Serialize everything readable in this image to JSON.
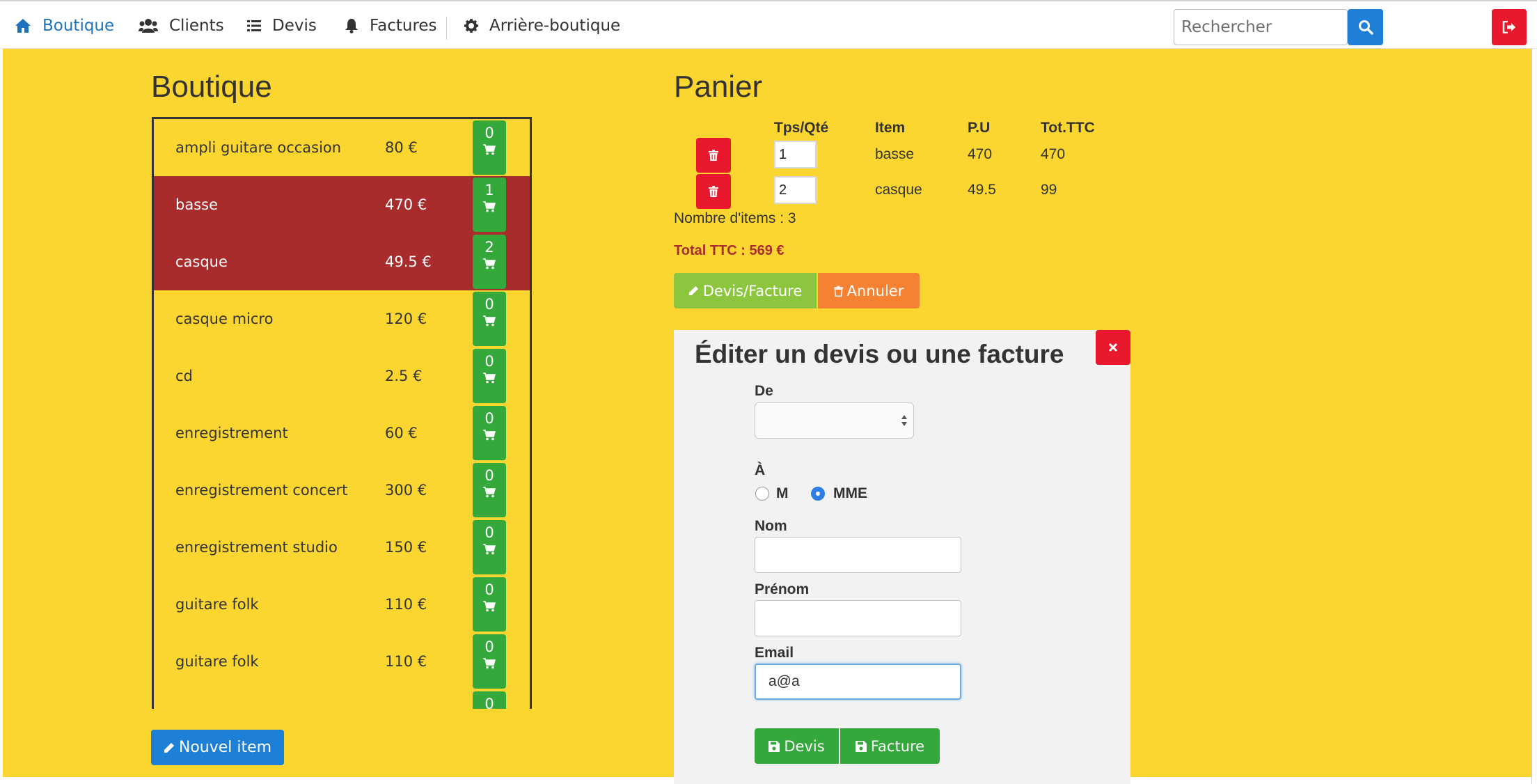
{
  "nav": {
    "items": [
      {
        "label": "Boutique",
        "icon": "home-icon"
      },
      {
        "label": "Clients",
        "icon": "users-icon"
      },
      {
        "label": "Devis",
        "icon": "list-icon"
      },
      {
        "label": "Factures",
        "icon": "bell-icon"
      },
      {
        "label": "Arrière-boutique",
        "icon": "gear-icon"
      }
    ],
    "search_placeholder": "Rechercher"
  },
  "boutique": {
    "title": "Boutique",
    "products": [
      {
        "name": "ampli guitare occasion",
        "price": "80 €",
        "count": "0",
        "selected": false
      },
      {
        "name": "basse",
        "price": "470 €",
        "count": "1",
        "selected": true
      },
      {
        "name": "casque",
        "price": "49.5 €",
        "count": "2",
        "selected": true
      },
      {
        "name": "casque micro",
        "price": "120 €",
        "count": "0",
        "selected": false
      },
      {
        "name": "cd",
        "price": "2.5 €",
        "count": "0",
        "selected": false
      },
      {
        "name": "enregistrement",
        "price": "60 €",
        "count": "0",
        "selected": false
      },
      {
        "name": "enregistrement concert",
        "price": "300 €",
        "count": "0",
        "selected": false
      },
      {
        "name": "enregistrement studio",
        "price": "150 €",
        "count": "0",
        "selected": false
      },
      {
        "name": "guitare folk",
        "price": "110 €",
        "count": "0",
        "selected": false
      },
      {
        "name": "guitare folk",
        "price": "110 €",
        "count": "0",
        "selected": false
      },
      {
        "name": "",
        "price": "",
        "count": "0",
        "selected": false
      }
    ],
    "new_item_label": "Nouvel item"
  },
  "panier": {
    "title": "Panier",
    "headers": {
      "qty": "Tps/Qté",
      "item": "Item",
      "pu": "P.U",
      "total": "Tot.TTC"
    },
    "rows": [
      {
        "qty": "1",
        "item": "basse",
        "pu": "470",
        "total": "470"
      },
      {
        "qty": "2",
        "item": "casque",
        "pu": "49.5",
        "total": "99"
      }
    ],
    "nb_items": "Nombre d'items : 3",
    "total_ttc": "Total TTC : 569 €",
    "devis_facture_label": "Devis/Facture",
    "annuler_label": "Annuler"
  },
  "edit": {
    "title": "Éditer un devis ou une facture",
    "de_label": "De",
    "de_value": "",
    "a_label": "À",
    "radio_m": "M",
    "radio_mme": "MME",
    "nom_label": "Nom",
    "nom_value": "",
    "prenom_label": "Prénom",
    "prenom_value": "",
    "email_label": "Email",
    "email_value": "a@a",
    "devis_label": "Devis",
    "facture_label": "Facture"
  },
  "colors": {
    "background": "#fbd530",
    "selected_row": "#a82c2c",
    "primary": "#1e7fd6",
    "success": "#35a83c",
    "danger": "#e8192c",
    "warning": "#f58232",
    "lime": "#8cc63f"
  }
}
